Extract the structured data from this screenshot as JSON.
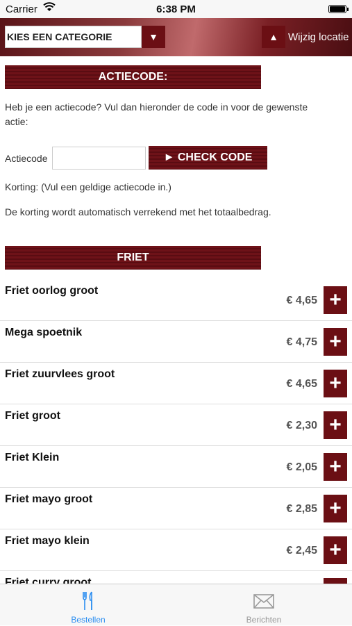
{
  "status_bar": {
    "carrier": "Carrier",
    "time": "6:38 PM"
  },
  "top_bar": {
    "category_placeholder": "KIES EEN CATEGORIE",
    "category_arrow": "▼",
    "location_arrow": "▲",
    "location_label": "Wijzig locatie"
  },
  "promo": {
    "header": "ACTIECODE:",
    "intro": "Heb je een actiecode? Vul dan hieronder de code in voor de gewenste actie:",
    "code_label": "Actiecode",
    "code_value": "",
    "check_button": "► CHECK CODE",
    "discount_text": "Korting: (Vul een geldige actiecode in.)",
    "note": "De korting wordt automatisch verrekend met het totaalbedrag."
  },
  "category": {
    "header": "FRIET",
    "items": [
      {
        "name": "Friet oorlog groot",
        "price": "€ 4,65"
      },
      {
        "name": "Mega spoetnik",
        "price": "€ 4,75"
      },
      {
        "name": "Friet zuurvlees groot",
        "price": "€ 4,65"
      },
      {
        "name": "Friet groot",
        "price": "€ 2,30"
      },
      {
        "name": "Friet Klein",
        "price": "€ 2,05"
      },
      {
        "name": "Friet mayo groot",
        "price": "€ 2,85"
      },
      {
        "name": "Friet mayo klein",
        "price": "€ 2,45"
      },
      {
        "name": "Friet curry groot",
        "price": ""
      }
    ],
    "add_symbol": "+"
  },
  "tab_bar": {
    "active_color": "#2a8df0",
    "inactive_color": "#999999",
    "tabs": [
      {
        "label": "Bestellen",
        "icon": "fork-knife-icon"
      },
      {
        "label": "Berichten",
        "icon": "envelope-icon"
      }
    ]
  },
  "colors": {
    "accent": "#6b0f14"
  }
}
